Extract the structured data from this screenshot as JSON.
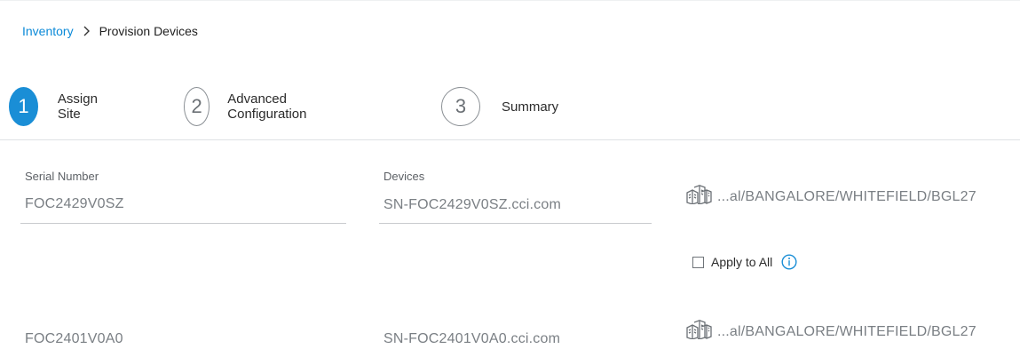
{
  "breadcrumb": {
    "parent": "Inventory",
    "current": "Provision Devices",
    "separator_icon": "chevron-right-icon"
  },
  "steps": [
    {
      "number": "1",
      "label": "Assign Site",
      "state": "active"
    },
    {
      "number": "2",
      "label": "Advanced Configuration",
      "state": "pending"
    },
    {
      "number": "3",
      "label": "Summary",
      "state": "pending"
    }
  ],
  "form": {
    "serial_label": "Serial Number",
    "devices_label": "Devices",
    "apply_to_all_label": "Apply to All",
    "apply_to_all_checked": false,
    "info_icon": "info-icon",
    "site_icon": "buildings-icon"
  },
  "rows": [
    {
      "serial": "FOC2429V0SZ",
      "device": "SN-FOC2429V0SZ.cci.com",
      "site": "...al/BANGALORE/WHITEFIELD/BGL27"
    },
    {
      "serial": "FOC2401V0A0",
      "device": "SN-FOC2401V0A0.cci.com",
      "site": "...al/BANGALORE/WHITEFIELD/BGL27"
    }
  ],
  "colors": {
    "accent": "#1a8ed6",
    "link": "#0b8ad8",
    "muted_text": "#7a7f84"
  }
}
